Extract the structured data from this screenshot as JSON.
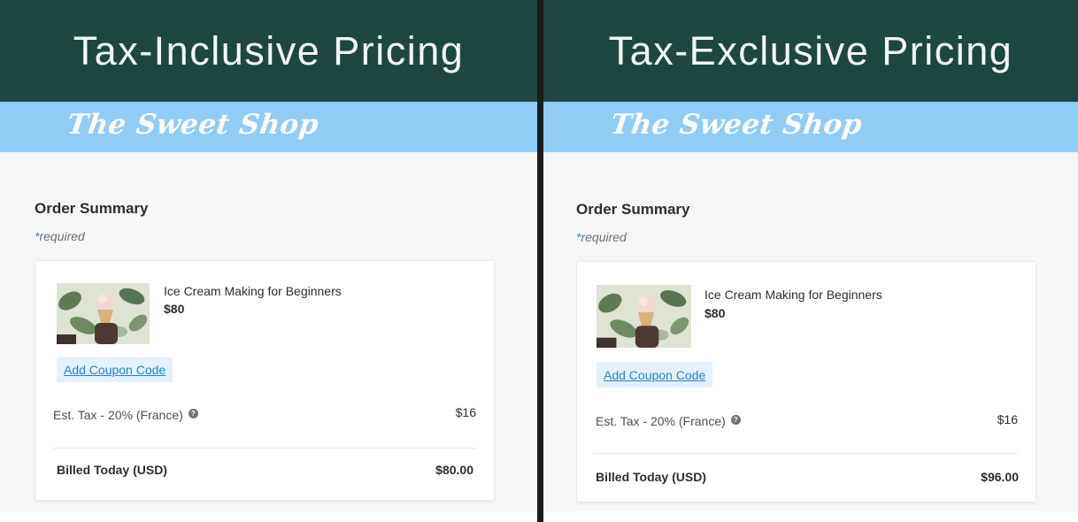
{
  "left": {
    "heading": "Tax-Inclusive Pricing",
    "logo_text": "The Sweet Shop",
    "order_summary_title": "Order Summary",
    "required_star": "*",
    "required_text": "required",
    "product_name": "Ice Cream Making for Beginners",
    "product_price": "$80",
    "coupon_label": "Add Coupon Code",
    "tax_label": "Est. Tax - 20% (France)",
    "tax_value": "$16",
    "billed_label": "Billed Today (USD)",
    "billed_value": "$80.00"
  },
  "right": {
    "heading": "Tax-Exclusive Pricing",
    "logo_text": "The Sweet Shop",
    "order_summary_title": "Order Summary",
    "required_star": "*",
    "required_text": "required",
    "product_name": "Ice Cream Making for Beginners",
    "product_price": "$80",
    "coupon_label": "Add Coupon Code",
    "tax_label": "Est. Tax - 20% (France)",
    "tax_value": "$16",
    "billed_label": "Billed Today (USD)",
    "billed_value": "$96.00"
  },
  "icons": {
    "help": "question-circle-icon",
    "product_image": "ice-cream-photo"
  },
  "colors": {
    "header_bg": "#1d4740",
    "banner_bg": "#8fcdf7",
    "link": "#1e86d0",
    "coupon_bg": "#e4f1fb"
  }
}
